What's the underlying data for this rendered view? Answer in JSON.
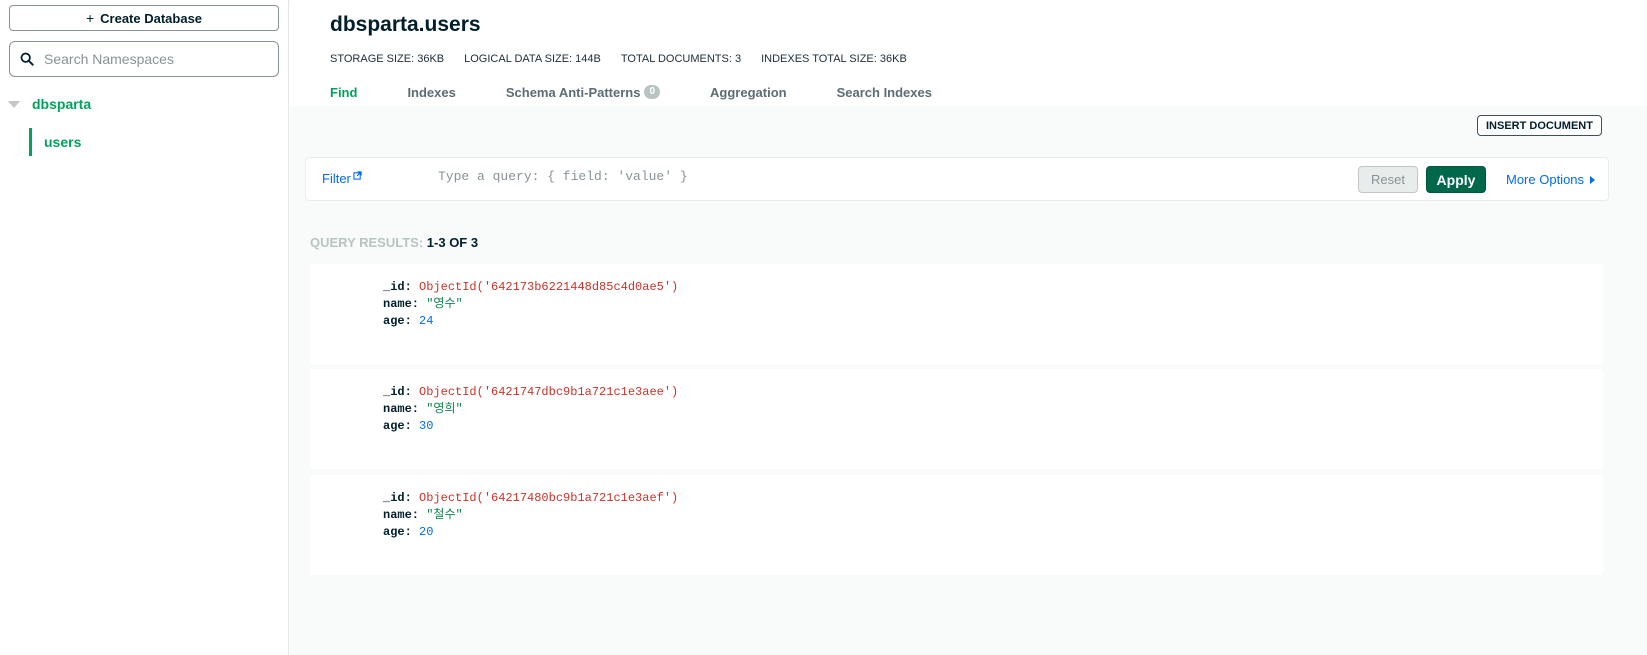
{
  "sidebar": {
    "create_database_label": "Create Database",
    "search_placeholder": "Search Namespaces",
    "database_name": "dbsparta",
    "collection_name": "users"
  },
  "header": {
    "namespace": "dbsparta.users",
    "stats": [
      "STORAGE SIZE: 36KB",
      "LOGICAL DATA SIZE: 144B",
      "TOTAL DOCUMENTS: 3",
      "INDEXES TOTAL SIZE: 36KB"
    ],
    "tabs": [
      {
        "label": "Find"
      },
      {
        "label": "Indexes"
      },
      {
        "label": "Schema Anti-Patterns",
        "badge": "0"
      },
      {
        "label": "Aggregation"
      },
      {
        "label": "Search Indexes"
      }
    ]
  },
  "toolbar": {
    "insert_document_label": "INSERT DOCUMENT"
  },
  "filter": {
    "label": "Filter",
    "placeholder": "Type a query: { field: 'value' }",
    "reset_label": "Reset",
    "apply_label": "Apply",
    "more_options_label": "More Options"
  },
  "results": {
    "label": "QUERY RESULTS:",
    "range": "1-3 OF 3"
  },
  "documents": [
    {
      "id_key": "_id:",
      "id_value": "ObjectId('642173b6221448d85c4d0ae5')",
      "name_key": "name:",
      "name_value": "\"영수\"",
      "age_key": "age:",
      "age_value": "24"
    },
    {
      "id_key": "_id:",
      "id_value": "ObjectId('6421747dbc9b1a721c1e3aee')",
      "name_key": "name:",
      "name_value": "\"영희\"",
      "age_key": "age:",
      "age_value": "30"
    },
    {
      "id_key": "_id:",
      "id_value": "ObjectId('64217480bc9b1a721c1e3aef')",
      "name_key": "name:",
      "name_value": "\"철수\"",
      "age_key": "age:",
      "age_value": "20"
    }
  ],
  "colors": {
    "accent_green": "#00a35c",
    "apply_green": "#00684a",
    "link_blue": "#016bf8",
    "objectid_red": "#cc3227"
  },
  "icons": [
    "plus-icon",
    "search-icon",
    "caret-down-icon",
    "external-link-icon",
    "triangle-right-icon"
  ]
}
